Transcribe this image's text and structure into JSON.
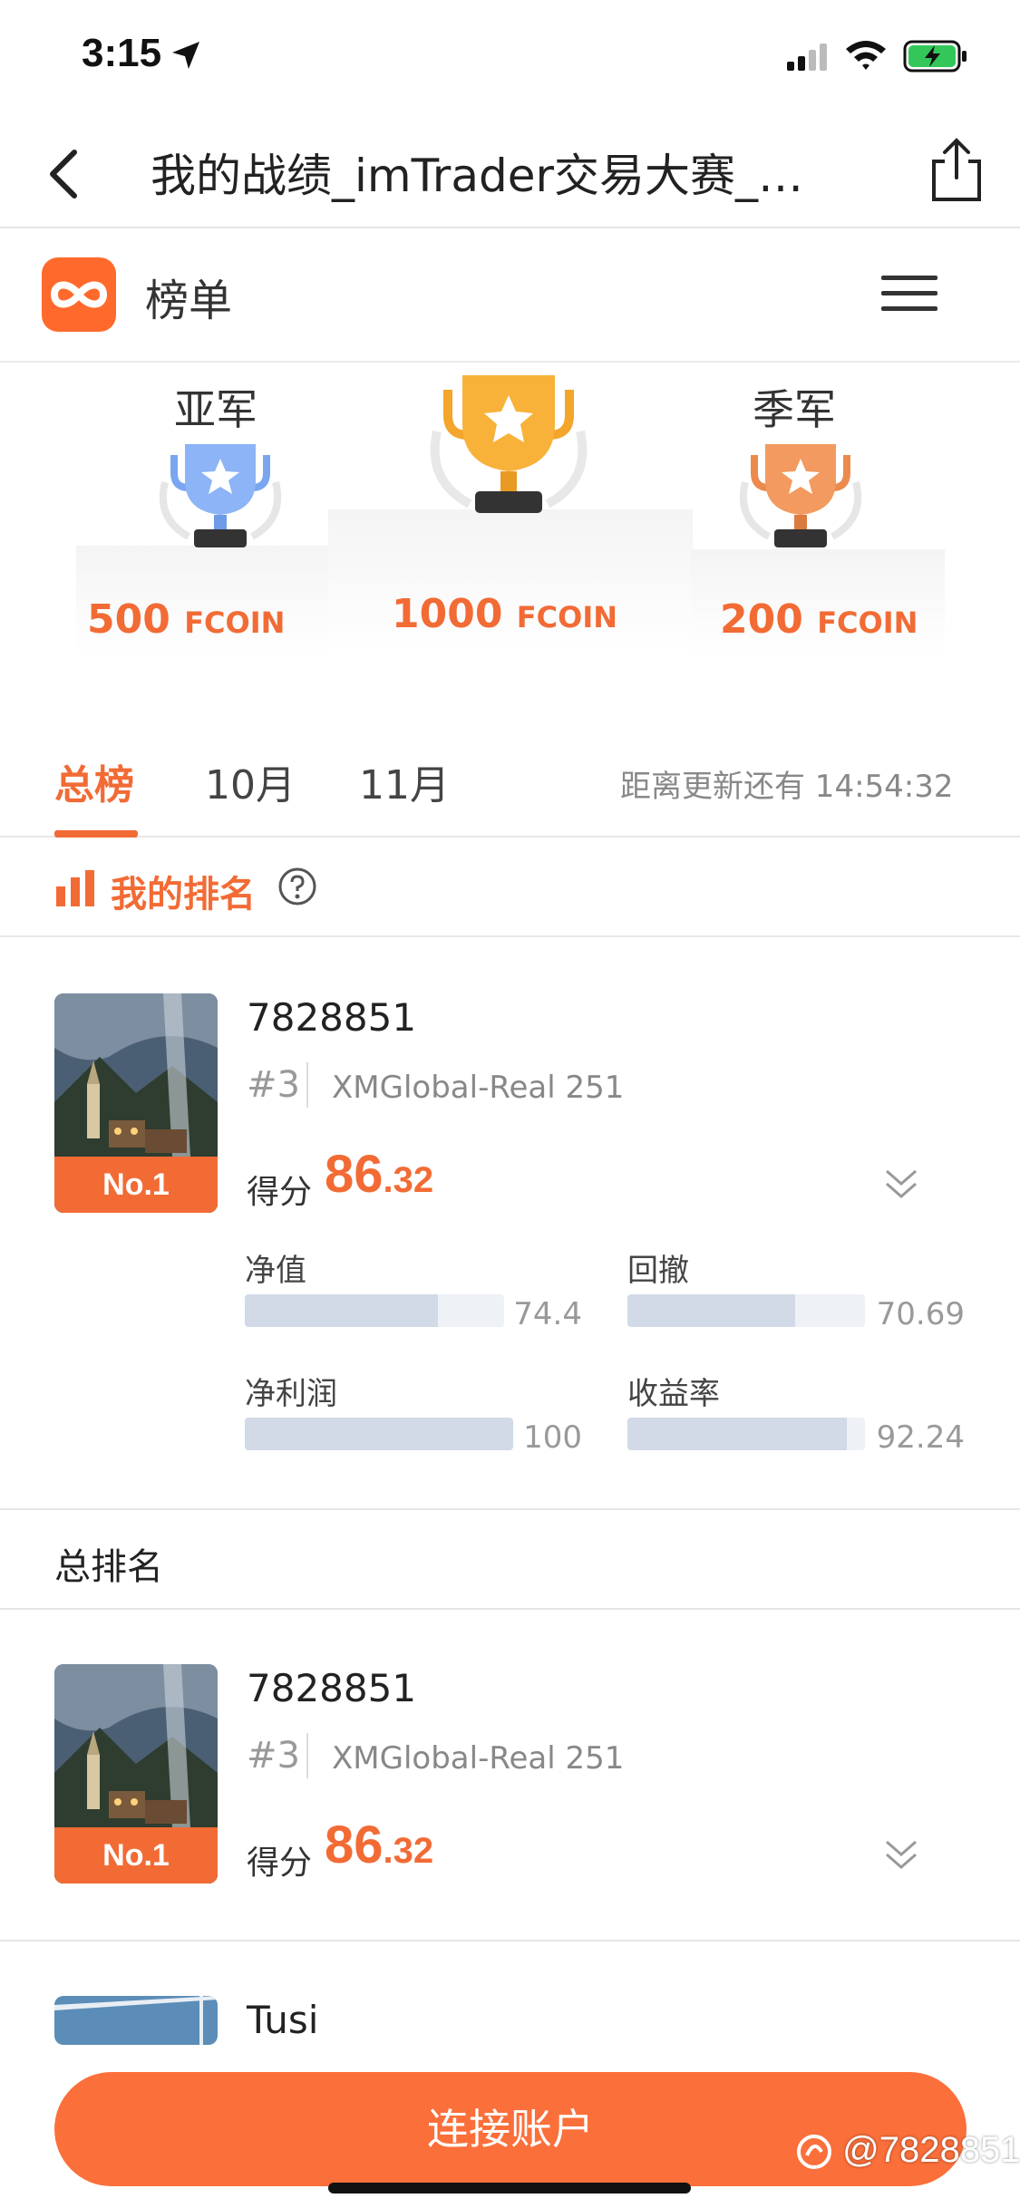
{
  "status_bar": {
    "time": "3:15"
  },
  "nav": {
    "title": "我的战绩_imTrader交易大赛_…"
  },
  "app": {
    "name": "榜单"
  },
  "podium": {
    "second": {
      "label": "亚军",
      "amount": "500",
      "unit": "FCOIN"
    },
    "first": {
      "amount": "1000",
      "unit": "FCOIN"
    },
    "third": {
      "label": "季军",
      "amount": "200",
      "unit": "FCOIN"
    }
  },
  "tabs": [
    {
      "label": "总榜",
      "active": true
    },
    {
      "label": "10月",
      "active": false
    },
    {
      "label": "11月",
      "active": false
    }
  ],
  "countdown": "距离更新还有 14:54:32",
  "my_rank": {
    "title": "我的排名",
    "user": {
      "badge": "No.1",
      "name": "7828851",
      "rank": "#3",
      "server": "XMGlobal-Real 251",
      "score_label": "得分",
      "score_int": "86",
      "score_dec": ".32"
    },
    "metrics": [
      {
        "label": "净值",
        "value": "74.4",
        "fill": 0.744
      },
      {
        "label": "回撤",
        "value": "70.69",
        "fill": 0.7069
      },
      {
        "label": "净利润",
        "value": "100",
        "fill": 1.0
      },
      {
        "label": "收益率",
        "value": "92.24",
        "fill": 0.9224
      }
    ]
  },
  "overall": {
    "title": "总排名",
    "entries": [
      {
        "badge": "No.1",
        "name": "7828851",
        "rank": "#3",
        "server": "XMGlobal-Real 251",
        "score_label": "得分",
        "score_int": "86",
        "score_dec": ".32"
      },
      {
        "name": "Tusi"
      }
    ]
  },
  "connect_button": "连接账户",
  "watermark": "@7828851",
  "colors": {
    "accent": "#f26b35",
    "button": "#fb6f3a",
    "bar_fill": "#d1dae6",
    "bar_track": "#eef1f6"
  }
}
